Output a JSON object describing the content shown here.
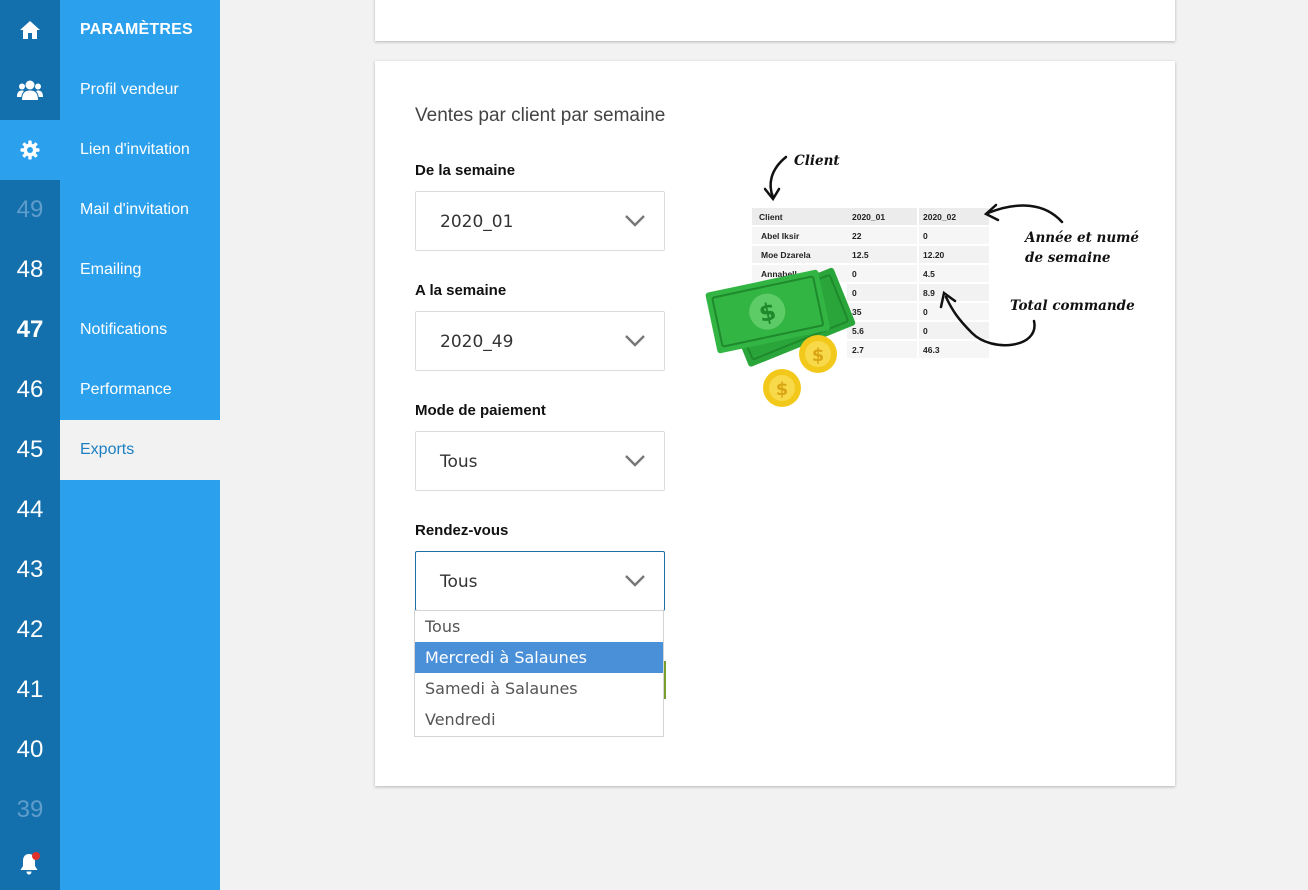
{
  "rail": {
    "items": [
      {
        "icon": "home-icon"
      },
      {
        "icon": "users-icon"
      },
      {
        "icon": "gear-icon"
      },
      {
        "label": "49"
      },
      {
        "label": "48"
      },
      {
        "label": "47"
      },
      {
        "label": "46"
      },
      {
        "label": "45"
      },
      {
        "label": "44"
      },
      {
        "label": "43"
      },
      {
        "label": "42"
      },
      {
        "label": "41"
      },
      {
        "label": "40"
      },
      {
        "label": "39"
      },
      {
        "icon": "bell-icon"
      }
    ]
  },
  "sidebar": {
    "title": "PARAMÈTRES",
    "items": [
      {
        "label": "Profil vendeur"
      },
      {
        "label": "Lien d'invitation"
      },
      {
        "label": "Mail d'invitation"
      },
      {
        "label": "Emailing"
      },
      {
        "label": "Notifications"
      },
      {
        "label": "Performance"
      },
      {
        "label": "Exports"
      }
    ],
    "selected": "Exports"
  },
  "form": {
    "title": "Ventes par client par semaine",
    "from_week": {
      "label": "De la semaine",
      "value": "2020_01"
    },
    "to_week": {
      "label": "A la semaine",
      "value": "2020_49"
    },
    "payment": {
      "label": "Mode de paiement",
      "value": "Tous"
    },
    "appointment": {
      "label": "Rendez-vous",
      "value": "Tous",
      "options": [
        "Tous",
        "Mercredi à Salaunes",
        "Samedi à Salaunes",
        "Vendredi"
      ],
      "highlighted": "Mercredi à Salaunes"
    }
  },
  "illustration": {
    "annotations": {
      "client": "Client",
      "year_week_line1": "Année et numéro",
      "year_week_line2": "de semaine",
      "total": "Total commande"
    },
    "table": {
      "headers": [
        "Client",
        "2020_01",
        "2020_02"
      ],
      "rows": [
        [
          "Abel Iksir",
          "22",
          "0"
        ],
        [
          "Moe Dzarela",
          "12.5",
          "12.20"
        ],
        [
          "Annabell... abete",
          "0",
          "4.5"
        ],
        [
          "",
          "0",
          "8.9"
        ],
        [
          "",
          "35",
          "0"
        ],
        [
          "",
          "5.6",
          "0"
        ],
        [
          "",
          "2.7",
          "46.3"
        ]
      ]
    }
  },
  "colors": {
    "rail": "#1470ac",
    "sidebar": "#2ba0ec",
    "highlight": "#4a90d9",
    "background": "#f2f2f2"
  }
}
